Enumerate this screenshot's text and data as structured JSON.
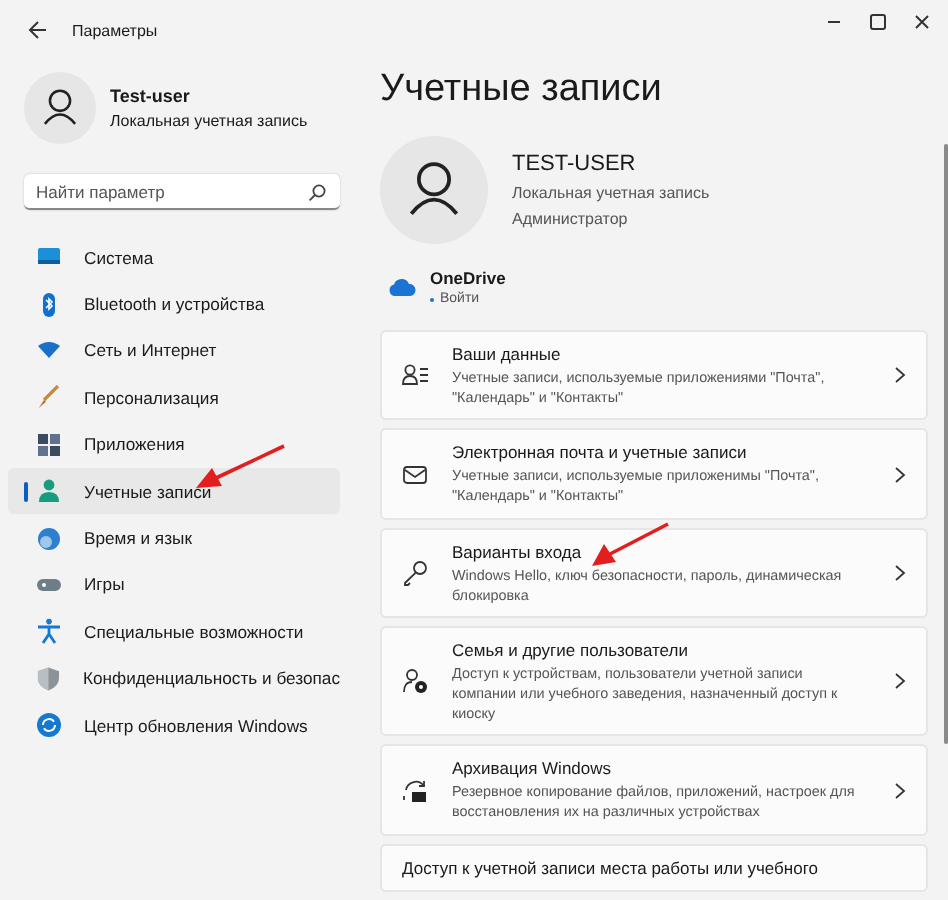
{
  "window": {
    "title": "Параметры"
  },
  "sidebar": {
    "user": {
      "name": "Test-user",
      "subtitle": "Локальная учетная запись"
    },
    "search": {
      "placeholder": "Найти параметр"
    },
    "items": [
      {
        "label": "Система",
        "selected": false
      },
      {
        "label": "Bluetooth и устройства",
        "selected": false
      },
      {
        "label": "Сеть и Интернет",
        "selected": false
      },
      {
        "label": "Персонализация",
        "selected": false
      },
      {
        "label": "Приложения",
        "selected": false
      },
      {
        "label": "Учетные записи",
        "selected": true
      },
      {
        "label": "Время и язык",
        "selected": false
      },
      {
        "label": "Игры",
        "selected": false
      },
      {
        "label": "Специальные возможности",
        "selected": false
      },
      {
        "label": "Конфиденциальность и безопас",
        "selected": false
      },
      {
        "label": "Центр обновления Windows",
        "selected": false
      }
    ]
  },
  "main": {
    "heading": "Учетные записи",
    "account": {
      "name": "TEST-USER",
      "lines": [
        "Локальная учетная запись",
        "Администратор"
      ]
    },
    "onedrive": {
      "title": "OneDrive",
      "action": "Войти"
    },
    "cards": [
      {
        "title": "Ваши данные",
        "description": "Учетные записи, используемые приложениями \"Почта\", \"Календарь\" и \"Контакты\""
      },
      {
        "title": "Электронная почта и учетные записи",
        "description": "Учетные записи, используемые приложенимы \"Почта\", \"Календарь\" и \"Контакты\""
      },
      {
        "title": "Варианты входа",
        "description": "Windows Hello, ключ безопасности, пароль, динамическая блокировка"
      },
      {
        "title": "Семья и другие пользователи",
        "description": "Доступ к устройствам, пользователи учетной записи компании или учебного заведения, назначенный доступ к киоску"
      },
      {
        "title": "Архивация Windows",
        "description": "Резервное копирование файлов, приложений, настроек для восстановления их на различных устройствах"
      },
      {
        "title": "Доступ к учетной записи места работы или учебного"
      }
    ]
  }
}
